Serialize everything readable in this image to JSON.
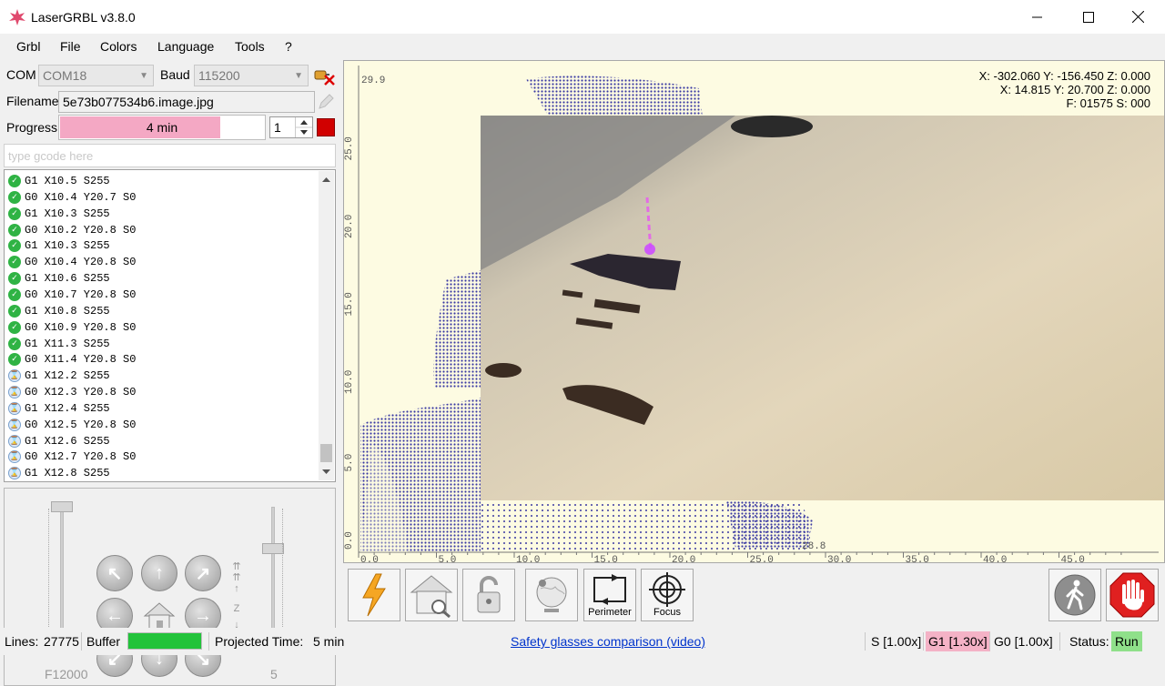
{
  "window": {
    "title": "LaserGRBL v3.8.0",
    "controls": [
      "minimize",
      "maximize",
      "close"
    ]
  },
  "menu": [
    "Grbl",
    "File",
    "Colors",
    "Language",
    "Tools",
    "?"
  ],
  "connection": {
    "com_label": "COM",
    "com_value": "COM18",
    "baud_label": "Baud",
    "baud_value": "115200"
  },
  "file": {
    "filename_label": "Filename",
    "filename_value": "5e73b077534b6.image.jpg",
    "progress_label": "Progress",
    "progress_text": "4 min",
    "progress_fraction": 0.78,
    "copies_value": "1"
  },
  "gcode_input": {
    "placeholder": "type gcode here"
  },
  "gcode_lines": [
    {
      "text": "G1 X10.5 S255",
      "status": "done"
    },
    {
      "text": "G0 X10.4 Y20.7 S0",
      "status": "done"
    },
    {
      "text": "G1 X10.3 S255",
      "status": "done"
    },
    {
      "text": "G0 X10.2 Y20.8 S0",
      "status": "done"
    },
    {
      "text": "G1 X10.3 S255",
      "status": "done"
    },
    {
      "text": "G0 X10.4 Y20.8 S0",
      "status": "done"
    },
    {
      "text": "G1 X10.6 S255",
      "status": "done"
    },
    {
      "text": "G0 X10.7 Y20.8 S0",
      "status": "done"
    },
    {
      "text": "G1 X10.8 S255",
      "status": "done"
    },
    {
      "text": "G0 X10.9 Y20.8 S0",
      "status": "done"
    },
    {
      "text": "G1 X11.3 S255",
      "status": "done"
    },
    {
      "text": "G0 X11.4 Y20.8 S0",
      "status": "done"
    },
    {
      "text": "G1 X12.2 S255",
      "status": "queued"
    },
    {
      "text": "G0 X12.3 Y20.8 S0",
      "status": "queued"
    },
    {
      "text": "G1 X12.4 S255",
      "status": "queued"
    },
    {
      "text": "G0 X12.5 Y20.8 S0",
      "status": "queued"
    },
    {
      "text": "G1 X12.6 S255",
      "status": "queued"
    },
    {
      "text": "G0 X12.7 Y20.8 S0",
      "status": "queued"
    },
    {
      "text": "G1 X12.8 S255",
      "status": "queued"
    }
  ],
  "jog": {
    "feed_label": "F12000",
    "step_label": "5",
    "z_label": "Z"
  },
  "canvas": {
    "coords_line1": "X: -302.060 Y: -156.450 Z: 0.000",
    "coords_line2": "X: 14.815 Y: 20.700 Z: 0.000",
    "coords_line3": "F: 01575 S: 000",
    "y_ticks": [
      "0.0",
      "5.0",
      "10.0",
      "15.0",
      "20.0",
      "25.0"
    ],
    "x_ticks": [
      "0.0",
      "5.0",
      "10.0",
      "15.0",
      "20.0",
      "25.0",
      "30.0",
      "35.0",
      "40.0",
      "45.0"
    ],
    "corner_top": "29.9",
    "corner_right": "28.8",
    "background_color": "#fdfbe2",
    "drawing_color": "#3b3aa3"
  },
  "toolbar": {
    "perimeter_label": "Perimeter",
    "focus_label": "Focus"
  },
  "status": {
    "lines_label": "Lines:",
    "lines_value": "27775",
    "buffer_label": "Buffer",
    "buffer_fraction": 1.0,
    "projected_label": "Projected Time:",
    "projected_value": "5 min",
    "link_text": "Safety glasses comparison (video)",
    "s_override": "S [1.00x]",
    "g1_override": "G1 [1.30x]",
    "g0_override": "G0 [1.00x]",
    "status_label": "Status:",
    "status_value": "Run",
    "accent_green": "#22c33a",
    "g1_highlight": "#f4b2c6"
  }
}
